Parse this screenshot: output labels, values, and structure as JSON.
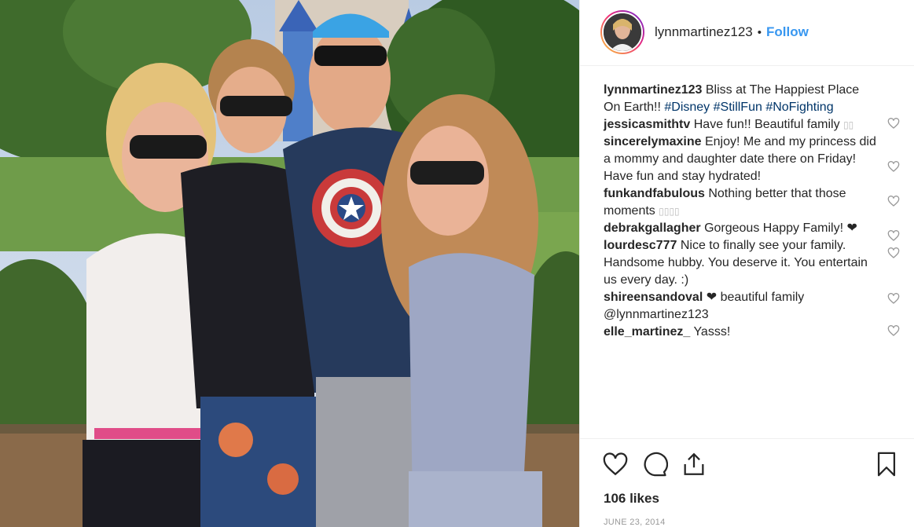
{
  "post": {
    "username": "lynnmartinez123",
    "separator": "•",
    "follow_label": "Follow",
    "caption": {
      "username": "lynnmartinez123",
      "text": "Bliss at The Happiest Place On Earth!!",
      "hashtags": "#Disney #StillFun #NoFighting"
    },
    "comments": [
      {
        "username": "jessicasmithtv",
        "text": "Have fun!! Beautiful family",
        "extra": "▯▯"
      },
      {
        "username": "sincerelymaxine",
        "text": "Enjoy! Me and my princess did a mommy and daughter date there on Friday! Have fun and stay hydrated!"
      },
      {
        "username": "funkandfabulous",
        "text": "Nothing better that those moments",
        "extra": "▯▯▯▯"
      },
      {
        "username": "debrakgallagher",
        "text": "Gorgeous Happy Family! ❤"
      },
      {
        "username": "lourdesc777",
        "text": "Nice to finally see your family. Handsome hubby. You deserve it. You entertain us every day. :)"
      },
      {
        "username": "shireensandoval",
        "text": "❤ beautiful family @lynnmartinez123"
      },
      {
        "username": "elle_martinez_",
        "text": "Yasss!"
      }
    ],
    "likes": "106 likes",
    "date": "JUNE 23, 2014"
  }
}
